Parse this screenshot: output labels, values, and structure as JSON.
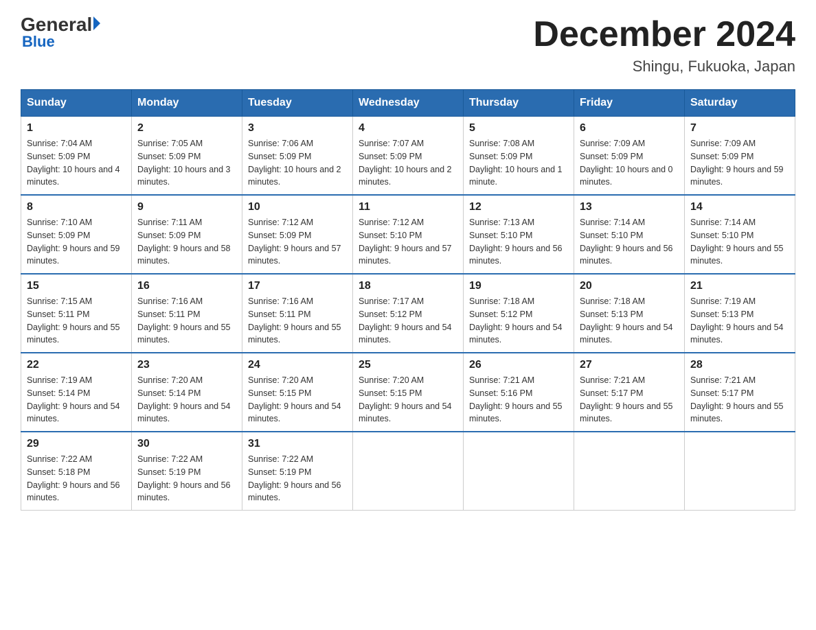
{
  "header": {
    "logo": {
      "general": "General",
      "blue": "Blue"
    },
    "title": "December 2024",
    "location": "Shingu, Fukuoka, Japan"
  },
  "weekdays": [
    "Sunday",
    "Monday",
    "Tuesday",
    "Wednesday",
    "Thursday",
    "Friday",
    "Saturday"
  ],
  "weeks": [
    [
      {
        "day": "1",
        "sunrise": "7:04 AM",
        "sunset": "5:09 PM",
        "daylight": "10 hours and 4 minutes."
      },
      {
        "day": "2",
        "sunrise": "7:05 AM",
        "sunset": "5:09 PM",
        "daylight": "10 hours and 3 minutes."
      },
      {
        "day": "3",
        "sunrise": "7:06 AM",
        "sunset": "5:09 PM",
        "daylight": "10 hours and 2 minutes."
      },
      {
        "day": "4",
        "sunrise": "7:07 AM",
        "sunset": "5:09 PM",
        "daylight": "10 hours and 2 minutes."
      },
      {
        "day": "5",
        "sunrise": "7:08 AM",
        "sunset": "5:09 PM",
        "daylight": "10 hours and 1 minute."
      },
      {
        "day": "6",
        "sunrise": "7:09 AM",
        "sunset": "5:09 PM",
        "daylight": "10 hours and 0 minutes."
      },
      {
        "day": "7",
        "sunrise": "7:09 AM",
        "sunset": "5:09 PM",
        "daylight": "9 hours and 59 minutes."
      }
    ],
    [
      {
        "day": "8",
        "sunrise": "7:10 AM",
        "sunset": "5:09 PM",
        "daylight": "9 hours and 59 minutes."
      },
      {
        "day": "9",
        "sunrise": "7:11 AM",
        "sunset": "5:09 PM",
        "daylight": "9 hours and 58 minutes."
      },
      {
        "day": "10",
        "sunrise": "7:12 AM",
        "sunset": "5:09 PM",
        "daylight": "9 hours and 57 minutes."
      },
      {
        "day": "11",
        "sunrise": "7:12 AM",
        "sunset": "5:10 PM",
        "daylight": "9 hours and 57 minutes."
      },
      {
        "day": "12",
        "sunrise": "7:13 AM",
        "sunset": "5:10 PM",
        "daylight": "9 hours and 56 minutes."
      },
      {
        "day": "13",
        "sunrise": "7:14 AM",
        "sunset": "5:10 PM",
        "daylight": "9 hours and 56 minutes."
      },
      {
        "day": "14",
        "sunrise": "7:14 AM",
        "sunset": "5:10 PM",
        "daylight": "9 hours and 55 minutes."
      }
    ],
    [
      {
        "day": "15",
        "sunrise": "7:15 AM",
        "sunset": "5:11 PM",
        "daylight": "9 hours and 55 minutes."
      },
      {
        "day": "16",
        "sunrise": "7:16 AM",
        "sunset": "5:11 PM",
        "daylight": "9 hours and 55 minutes."
      },
      {
        "day": "17",
        "sunrise": "7:16 AM",
        "sunset": "5:11 PM",
        "daylight": "9 hours and 55 minutes."
      },
      {
        "day": "18",
        "sunrise": "7:17 AM",
        "sunset": "5:12 PM",
        "daylight": "9 hours and 54 minutes."
      },
      {
        "day": "19",
        "sunrise": "7:18 AM",
        "sunset": "5:12 PM",
        "daylight": "9 hours and 54 minutes."
      },
      {
        "day": "20",
        "sunrise": "7:18 AM",
        "sunset": "5:13 PM",
        "daylight": "9 hours and 54 minutes."
      },
      {
        "day": "21",
        "sunrise": "7:19 AM",
        "sunset": "5:13 PM",
        "daylight": "9 hours and 54 minutes."
      }
    ],
    [
      {
        "day": "22",
        "sunrise": "7:19 AM",
        "sunset": "5:14 PM",
        "daylight": "9 hours and 54 minutes."
      },
      {
        "day": "23",
        "sunrise": "7:20 AM",
        "sunset": "5:14 PM",
        "daylight": "9 hours and 54 minutes."
      },
      {
        "day": "24",
        "sunrise": "7:20 AM",
        "sunset": "5:15 PM",
        "daylight": "9 hours and 54 minutes."
      },
      {
        "day": "25",
        "sunrise": "7:20 AM",
        "sunset": "5:15 PM",
        "daylight": "9 hours and 54 minutes."
      },
      {
        "day": "26",
        "sunrise": "7:21 AM",
        "sunset": "5:16 PM",
        "daylight": "9 hours and 55 minutes."
      },
      {
        "day": "27",
        "sunrise": "7:21 AM",
        "sunset": "5:17 PM",
        "daylight": "9 hours and 55 minutes."
      },
      {
        "day": "28",
        "sunrise": "7:21 AM",
        "sunset": "5:17 PM",
        "daylight": "9 hours and 55 minutes."
      }
    ],
    [
      {
        "day": "29",
        "sunrise": "7:22 AM",
        "sunset": "5:18 PM",
        "daylight": "9 hours and 56 minutes."
      },
      {
        "day": "30",
        "sunrise": "7:22 AM",
        "sunset": "5:19 PM",
        "daylight": "9 hours and 56 minutes."
      },
      {
        "day": "31",
        "sunrise": "7:22 AM",
        "sunset": "5:19 PM",
        "daylight": "9 hours and 56 minutes."
      },
      null,
      null,
      null,
      null
    ]
  ],
  "labels": {
    "sunrise": "Sunrise:",
    "sunset": "Sunset:",
    "daylight": "Daylight:"
  }
}
